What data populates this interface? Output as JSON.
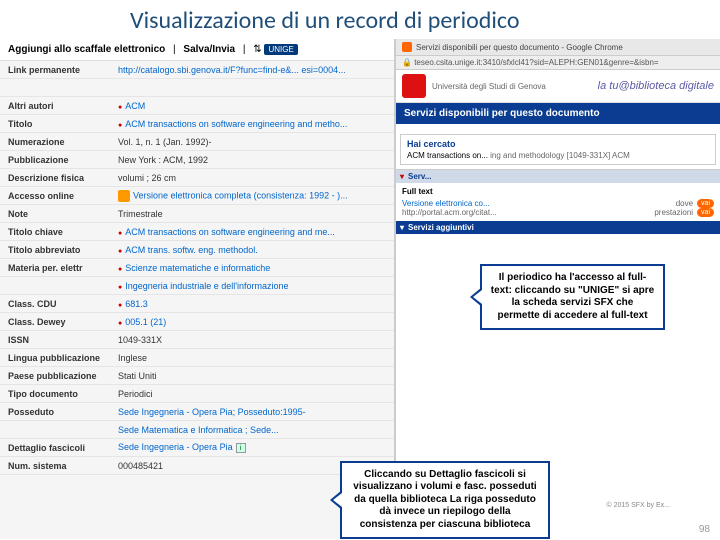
{
  "title": "Visualizzazione di un record di periodico",
  "actionBar": {
    "addShelf": "Aggiungi allo scaffale elettronico",
    "saveSend": "Salva/Invia",
    "badgeIcon": "⇅",
    "unigeBadge": "UNIGE"
  },
  "fields": {
    "linkPermanente": {
      "label": "Link permanente",
      "value": "http://catalogo.sbi.genova.it/F?func=find-e&... esi=0004..."
    },
    "altriAutori": {
      "label": "Altri autori",
      "value": "ACM"
    },
    "titolo": {
      "label": "Titolo",
      "value": "ACM transactions on software engineering and metho..."
    },
    "numerazione": {
      "label": "Numerazione",
      "value": "Vol. 1, n. 1 (Jan. 1992)-"
    },
    "pubblicazione": {
      "label": "Pubblicazione",
      "value": "New York : ACM, 1992"
    },
    "descrizioneFisica": {
      "label": "Descrizione fisica",
      "value": "volumi ; 26 cm"
    },
    "accessoOnline": {
      "label": "Accesso online",
      "value": "Versione elettronica completa (consistenza: 1992 - )..."
    },
    "note": {
      "label": "Note",
      "value": "Trimestrale"
    },
    "titoloChiave": {
      "label": "Titolo chiave",
      "value": "ACM transactions on software engineering and me..."
    },
    "titoloAbbreviato": {
      "label": "Titolo abbreviato",
      "value": "ACM trans. softw. eng. methodol."
    },
    "materiaElettr": {
      "label": "Materia per. elettr",
      "value1": "Scienze matematiche e informatiche",
      "value2": "Ingegneria industriale e dell'informazione"
    },
    "classCDU": {
      "label": "Class. CDU",
      "value": "681.3"
    },
    "classDewey": {
      "label": "Class. Dewey",
      "value": "005.1 (21)"
    },
    "issn": {
      "label": "ISSN",
      "value": "1049-331X"
    },
    "linguaPubblicazione": {
      "label": "Lingua pubblicazione",
      "value": "Inglese"
    },
    "paesePubblicazione": {
      "label": "Paese pubblicazione",
      "value": "Stati Uniti"
    },
    "tipoDocumento": {
      "label": "Tipo documento",
      "value": "Periodici"
    },
    "posseduto": {
      "label": "Posseduto",
      "value1": "Sede Ingegneria - Opera Pia; Posseduto:1995-",
      "value2": "Sede Matematica e Informatica ; Sede..."
    },
    "dettaglioFascicoli": {
      "label": "Dettaglio fascicoli",
      "value": "Sede Ingegneria - Opera Pia"
    },
    "numSistema": {
      "label": "Num. sistema",
      "value": "000485421"
    }
  },
  "browser": {
    "tabTitle": "Servizi disponibili per questo documento - Google Chrome",
    "url": "teseo.csita.unige.it:3410/sfxlcl41?sid=ALEPH:GEN01&genre=&isbn=",
    "uniName": "Università degli Studi di Genova",
    "libLabel": "la tu@biblioteca digitale",
    "blueBarTitle": "Servizi disponibili per questo documento",
    "haiCercato": {
      "label": "Hai cercato",
      "text": "ACM transactions on...",
      "suffix": "ing and methodology [1049-331X] ACM"
    },
    "sfx": {
      "fullTextSection": "Serv...",
      "fullTextLabel": "Full text",
      "versione": "Versione elettronica co...",
      "portal": "http://portal.acm.org/citat...",
      "dove": "dove",
      "prestazioni": "prestazioni",
      "serviziAgg": "Servizi aggiuntivi",
      "goBtn": "vai"
    },
    "copyright": "© 2015 SFX by Ex..."
  },
  "callouts": {
    "c1": "Il periodico ha l'accesso al full-text: cliccando su \"UNIGE\" si apre la scheda servizi SFX che permette di accedere al full-text",
    "c2": "Cliccando su Dettaglio fascicoli si visualizzano i volumi e fasc. posseduti da quella biblioteca La riga posseduto dà invece un riepilogo della consistenza per ciascuna biblioteca"
  },
  "pageNumber": "98"
}
